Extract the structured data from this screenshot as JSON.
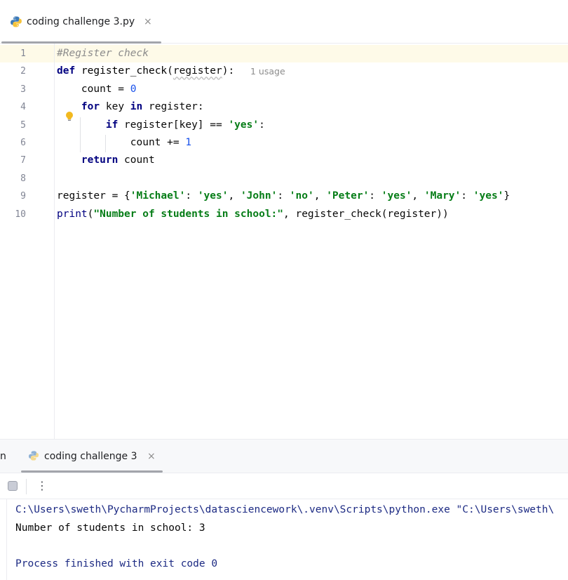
{
  "editor_tab": {
    "filename": "coding challenge 3.py",
    "icon": "python-file-icon",
    "close_glyph": "×"
  },
  "editor": {
    "line_numbers": [
      "1",
      "2",
      "3",
      "4",
      "5",
      "6",
      "7",
      "8",
      "9",
      "10"
    ],
    "inlay_hint": "1 usage"
  },
  "run_panel": {
    "clipped_tab_label": "n",
    "tab_label": "coding challenge 3",
    "close_glyph": "×",
    "more_glyph": "⋮",
    "console_lines": [
      "C:\\Users\\sweth\\PycharmProjects\\datasciencework\\.venv\\Scripts\\python.exe \"C:\\Users\\sweth\\",
      "Number of students in school: 3",
      "",
      "Process finished with exit code 0"
    ]
  },
  "colors": {
    "keyword": "#0033b3",
    "string": "#067d17",
    "number": "#1750eb",
    "comment": "#8c8c8c",
    "current_line": "#fefae8"
  }
}
